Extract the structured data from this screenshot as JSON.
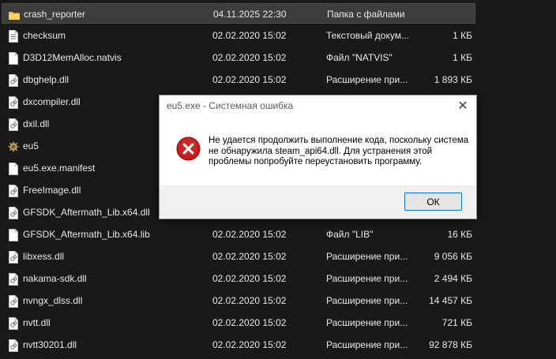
{
  "files": [
    {
      "name": "crash_reporter",
      "date": "04.11.2025 22:30",
      "type": "Папка с файлами",
      "size": "",
      "icon": "folder-icon",
      "selected": true
    },
    {
      "name": "checksum",
      "date": "02.02.2020 15:02",
      "type": "Текстовый докум...",
      "size": "1 КБ",
      "icon": "text-file-icon"
    },
    {
      "name": "D3D12MemAlloc.natvis",
      "date": "02.02.2020 15:02",
      "type": "Файл \"NATVIS\"",
      "size": "1 КБ",
      "icon": "file-icon"
    },
    {
      "name": "dbghelp.dll",
      "date": "02.02.2020 15:02",
      "type": "Расширение при...",
      "size": "1 893 КБ",
      "icon": "dll-file-icon"
    },
    {
      "name": "dxcompiler.dll",
      "date": "",
      "type": "",
      "size": "",
      "icon": "dll-file-icon"
    },
    {
      "name": "dxil.dll",
      "date": "",
      "type": "",
      "size": "",
      "icon": "dll-file-icon"
    },
    {
      "name": "eu5",
      "date": "",
      "type": "",
      "size": "",
      "icon": "app-exe-icon"
    },
    {
      "name": "eu5.exe.manifest",
      "date": "",
      "type": "",
      "size": "",
      "icon": "file-icon"
    },
    {
      "name": "FreeImage.dll",
      "date": "",
      "type": "",
      "size": "",
      "icon": "dll-file-icon"
    },
    {
      "name": "GFSDK_Aftermath_Lib.x64.dll",
      "date": "",
      "type": "",
      "size": "",
      "icon": "dll-file-icon"
    },
    {
      "name": "GFSDK_Aftermath_Lib.x64.lib",
      "date": "02.02.2020 15:02",
      "type": "Файл \"LIB\"",
      "size": "16 КБ",
      "icon": "file-icon"
    },
    {
      "name": "libxess.dll",
      "date": "02.02.2020 15:02",
      "type": "Расширение при...",
      "size": "9 056 КБ",
      "icon": "dll-file-icon"
    },
    {
      "name": "nakama-sdk.dll",
      "date": "02.02.2020 15:02",
      "type": "Расширение при...",
      "size": "2 494 КБ",
      "icon": "dll-file-icon"
    },
    {
      "name": "nvngx_dlss.dll",
      "date": "02.02.2020 15:02",
      "type": "Расширение при...",
      "size": "14 457 КБ",
      "icon": "dll-file-icon"
    },
    {
      "name": "nvtt.dll",
      "date": "02.02.2020 15:02",
      "type": "Расширение при...",
      "size": "721 КБ",
      "icon": "dll-file-icon"
    },
    {
      "name": "nvtt30201.dll",
      "date": "02.02.2020 15:02",
      "type": "Расширение при...",
      "size": "92 878 КБ",
      "icon": "dll-file-icon"
    }
  ],
  "dialog": {
    "title": "eu5.exe - Системная ошибка",
    "close_symbol": "✕",
    "icon": "error-icon",
    "message": "Не удается продолжить выполнение кода, поскольку система не обнаружила steam_api64.dll. Для устранения этой проблемы попробуйте переустановить программу.",
    "ok_label": "ОК"
  },
  "colors": {
    "background": "#191919",
    "selected_row": "#3d3d3d",
    "error_red": "#c41a1a",
    "button_border": "#0078d4"
  }
}
